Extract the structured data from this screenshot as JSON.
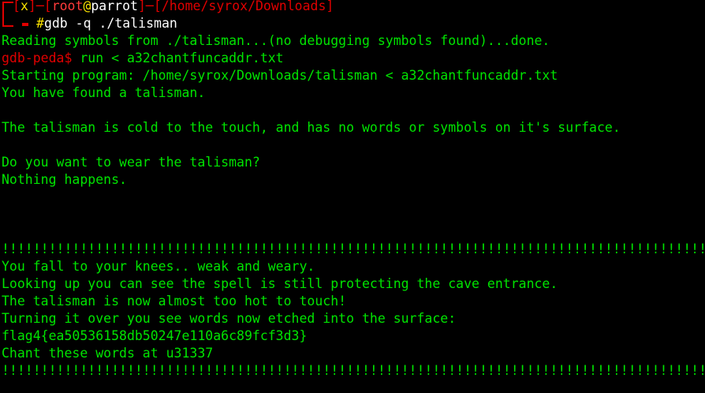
{
  "prompt": {
    "open_bracket": "[",
    "status": "x",
    "close_bracket": "]",
    "sep": "─",
    "user_open": "[",
    "user": "root",
    "at": "@",
    "host": "parrot",
    "user_close": "]",
    "path_open": "[",
    "path": "/home/syrox/Downloads",
    "path_close": "]",
    "hash": "#",
    "command": "gdb -q ./talisman"
  },
  "output": {
    "reading": "Reading symbols from ./talisman...(no debugging symbols found)...done.",
    "gdb_prompt": "gdb-peda$",
    "gdb_command": " run < a32chantfuncaddr.txt",
    "starting": "Starting program: /home/syrox/Downloads/talisman < a32chantfuncaddr.txt",
    "found": "You have found a talisman.",
    "cold": "The talisman is cold to the touch, and has no words or symbols on it's surface.",
    "wear": "Do you want to wear the talisman?",
    "nothing": "Nothing happens.",
    "bang1": "!!!!!!!!!!!!!!!!!!!!!!!!!!!!!!!!!!!!!!!!!!!!!!!!!!!!!!!!!!!!!!!!!!!!!!!!!!!!!!!!!!!!!!!!!!!!",
    "knees": "You fall to your knees.. weak and weary.",
    "looking": "Looking up you can see the spell is still protecting the cave entrance.",
    "hot": "The talisman is now almost too hot to touch!",
    "turning": "Turning it over you see words now etched into the surface:",
    "flag": "flag4{ea50536158db50247e110a6c89fcf3d3}",
    "chant": "Chant these words at u31337",
    "bang2": "!!!!!!!!!!!!!!!!!!!!!!!!!!!!!!!!!!!!!!!!!!!!!!!!!!!!!!!!!!!!!!!!!!!!!!!!!!!!!!!!!!!!!!!!!!!!"
  },
  "colors": {
    "background": "#000000",
    "text_green": "#00e400",
    "prompt_red": "#e00000",
    "prompt_white": "#ffffff",
    "hash_yellow": "#f8e000"
  }
}
